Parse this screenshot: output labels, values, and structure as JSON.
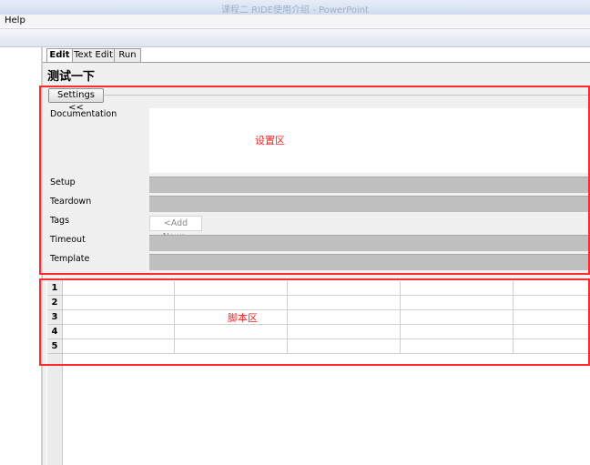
{
  "window": {
    "title": "课程二 RIDE使用介绍 - PowerPoint"
  },
  "menu": {
    "help": "Help"
  },
  "tabs": [
    "Edit",
    "Text Edit",
    "Run"
  ],
  "editor": {
    "heading": "测试一下",
    "settings_button": "Settings <<",
    "fields": {
      "documentation": "Documentation",
      "setup": "Setup",
      "teardown": "Teardown",
      "tags": "Tags",
      "timeout": "Timeout",
      "template": "Template"
    },
    "tags_placeholder": "<Add New>",
    "settings_zone_label": "设置区"
  },
  "grid": {
    "row_numbers": [
      "1",
      "2",
      "3",
      "4",
      "5"
    ],
    "script_zone_label": "脚本区"
  },
  "annotation_color": "#ff2a2a"
}
